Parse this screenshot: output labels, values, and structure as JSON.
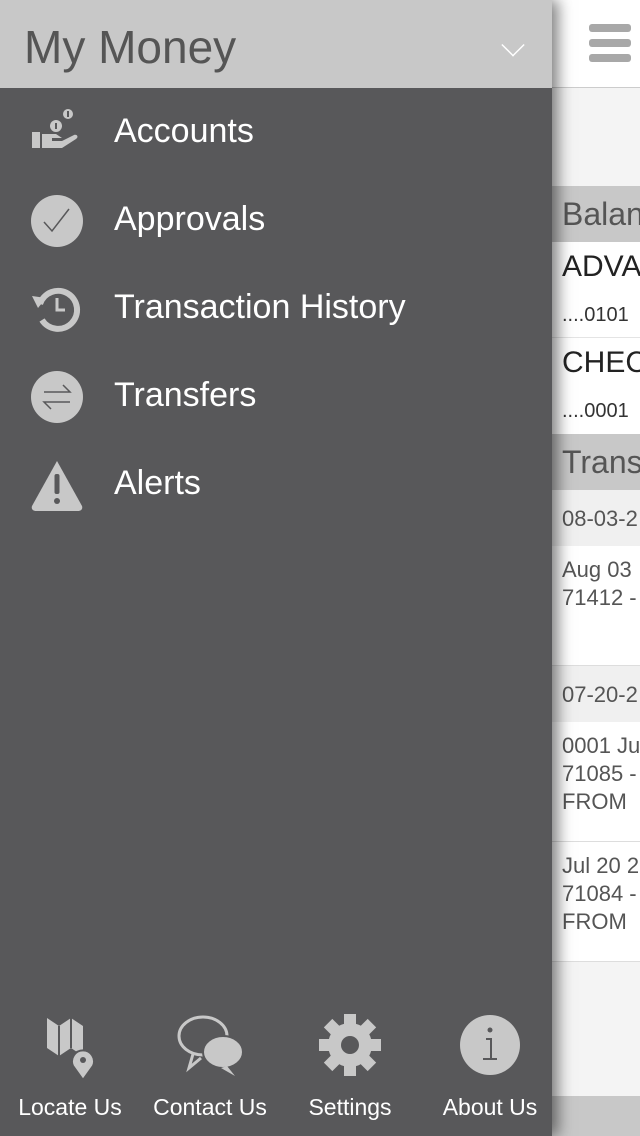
{
  "drawer": {
    "title": "My Money",
    "menu": [
      {
        "label": "Accounts",
        "icon": "accounts-hand-coins-icon"
      },
      {
        "label": "Approvals",
        "icon": "checkmark-circle-icon"
      },
      {
        "label": "Transaction History",
        "icon": "history-icon"
      },
      {
        "label": "Transfers",
        "icon": "transfer-arrows-icon"
      },
      {
        "label": "Alerts",
        "icon": "warning-icon"
      }
    ],
    "footer": [
      {
        "label": "Locate Us",
        "icon": "map-pin-icon"
      },
      {
        "label": "Contact Us",
        "icon": "chat-bubbles-icon"
      },
      {
        "label": "Settings",
        "icon": "gear-icon"
      },
      {
        "label": "About Us",
        "icon": "info-icon"
      }
    ]
  },
  "main": {
    "balances_header": "Balan",
    "accounts": [
      {
        "name": "ADVA",
        "number": "....0101"
      },
      {
        "name": "CHEC",
        "number": "....0001"
      }
    ],
    "transactions_header": "Trans",
    "groups": [
      {
        "date": "08-03-2",
        "items": [
          [
            "Aug 03",
            "71412 -"
          ]
        ]
      },
      {
        "date": "07-20-2",
        "items": [
          [
            "0001 Ju",
            "71085 -",
            "FROM"
          ],
          [
            "Jul 20 2",
            "71084 -",
            "FROM"
          ]
        ]
      }
    ]
  }
}
